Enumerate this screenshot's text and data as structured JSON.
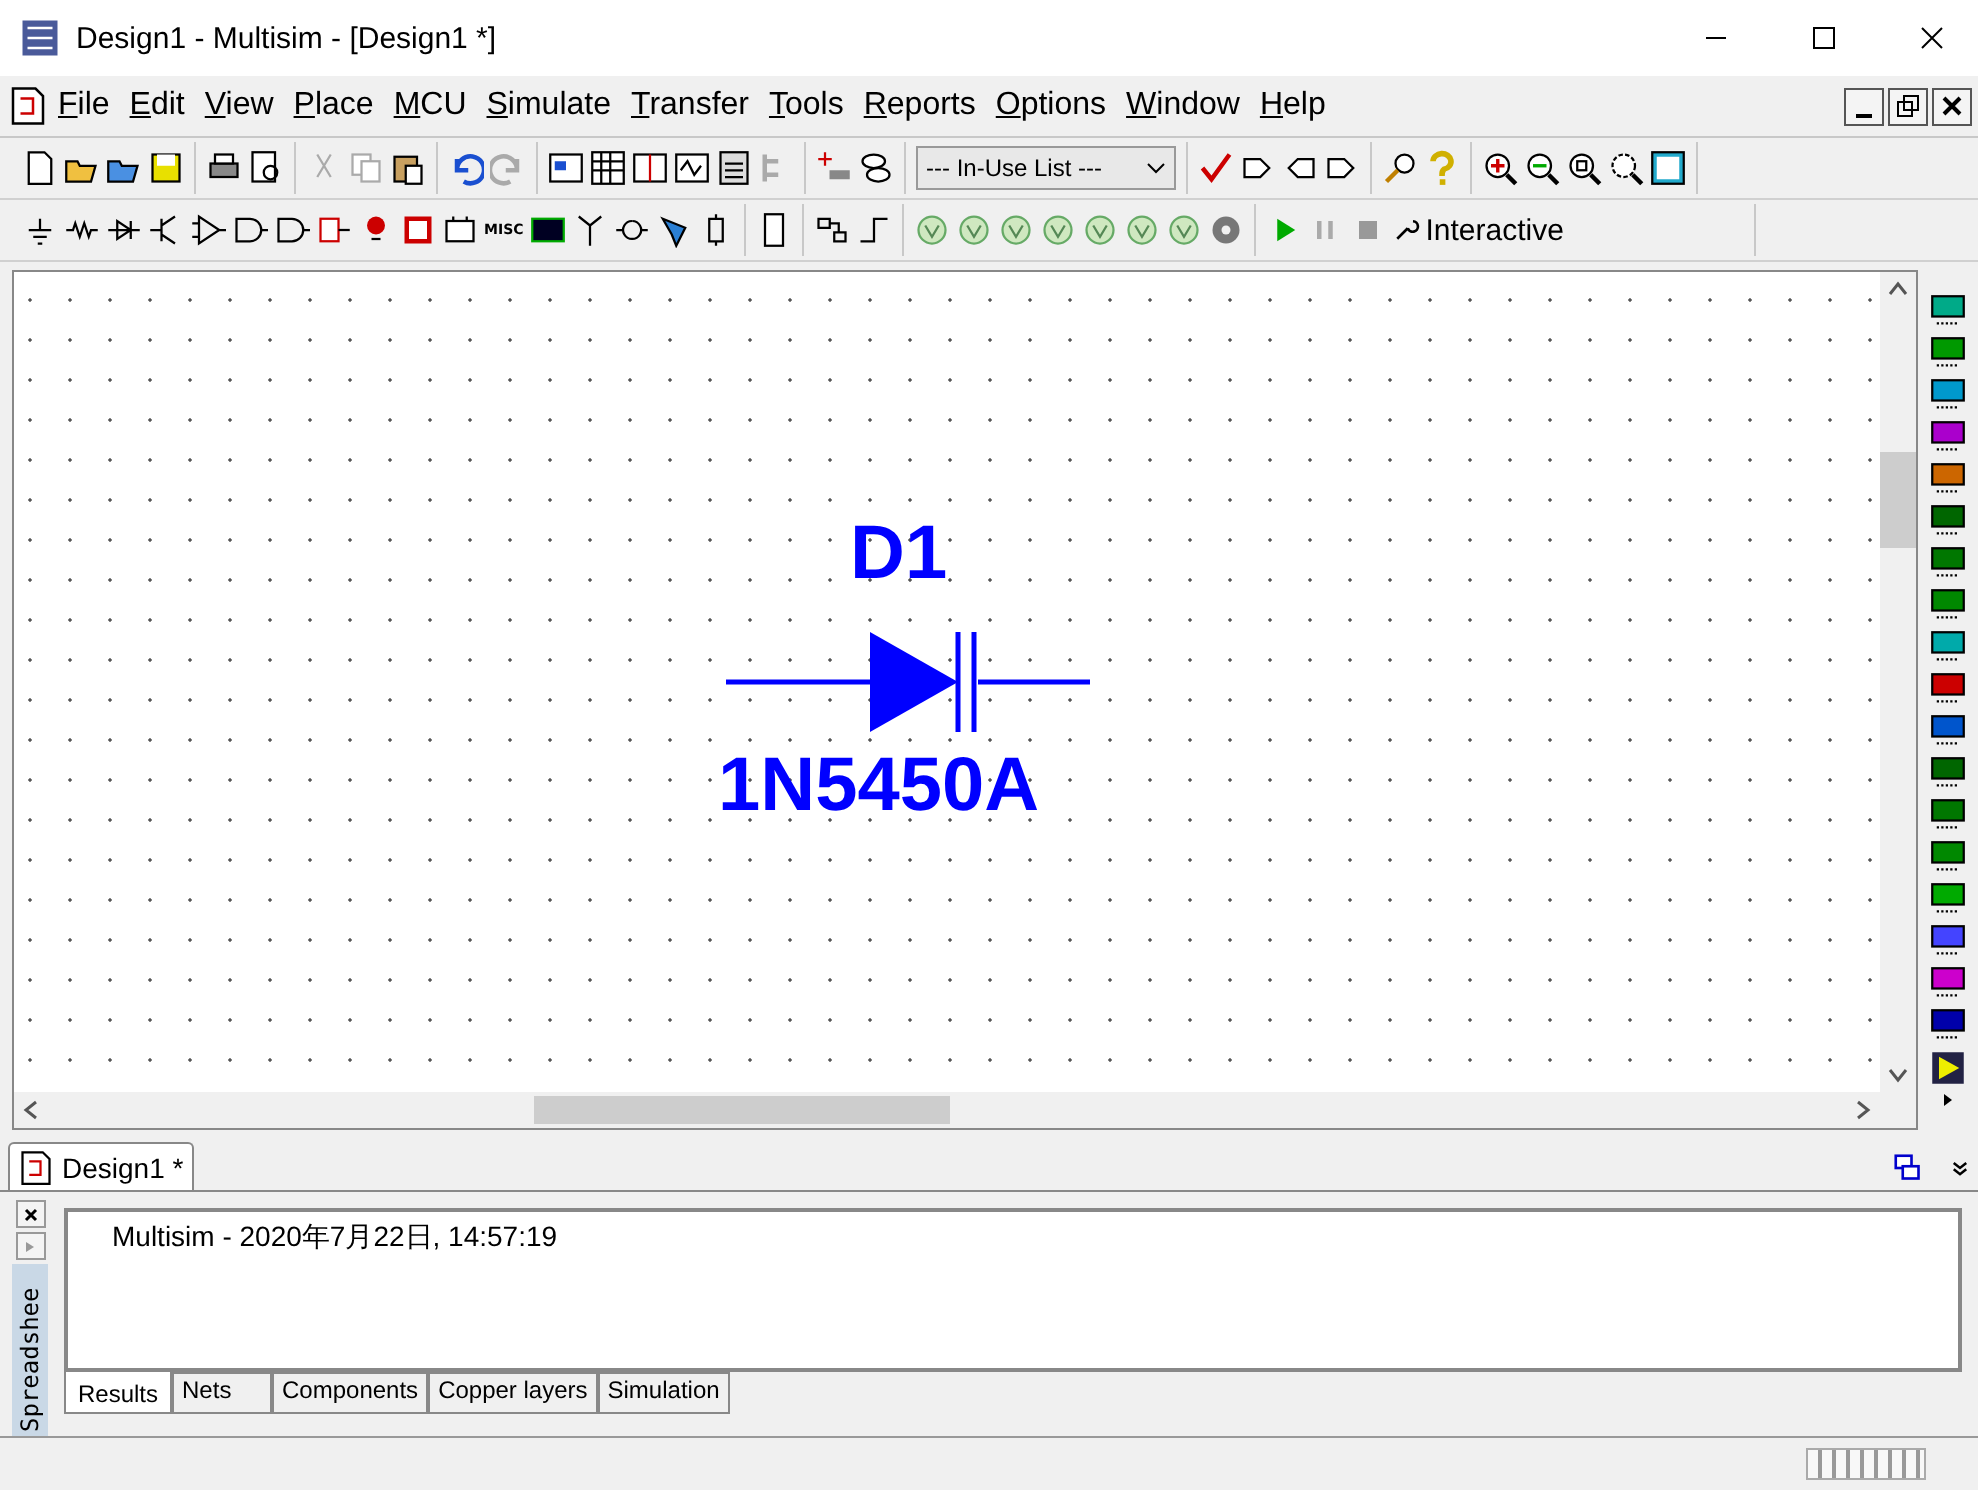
{
  "window": {
    "title": "Design1 - Multisim - [Design1 *]"
  },
  "menu": [
    "File",
    "Edit",
    "View",
    "Place",
    "MCU",
    "Simulate",
    "Transfer",
    "Tools",
    "Reports",
    "Options",
    "Window",
    "Help"
  ],
  "toolbar": {
    "in_use_list": "--- In-Use List ---",
    "misc_label": "MISC",
    "interactive": "Interactive"
  },
  "schematic": {
    "component": {
      "ref": "D1",
      "value": "1N5450A"
    }
  },
  "document_tabs": [
    {
      "label": "Design1 *",
      "selected": true
    }
  ],
  "spreadsheet": {
    "title": "Spreadshee",
    "log": "Multisim  -  2020年7月22日, 14:57:19",
    "tabs": [
      {
        "label": "Results",
        "selected": true
      },
      {
        "label": "Nets",
        "selected": false
      },
      {
        "label": "Components",
        "selected": false
      },
      {
        "label": "Copper layers",
        "selected": false
      },
      {
        "label": "Simulation",
        "selected": false
      }
    ]
  }
}
